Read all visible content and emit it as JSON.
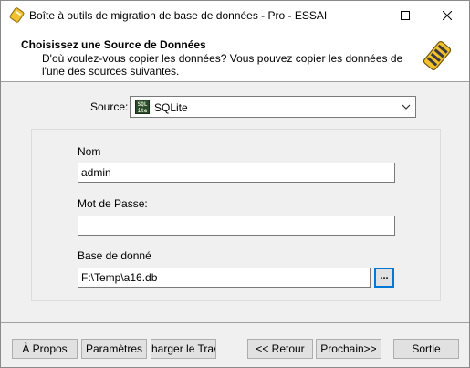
{
  "window": {
    "title": "Boîte à outils de migration de base de données - Pro - ESSAI"
  },
  "header": {
    "title": "Choisissez une Source de Données",
    "description": "D'où voulez-vous copier les données? Vous pouvez copier les données de l'une des sources suivantes."
  },
  "source": {
    "label": "Source:",
    "selected": "SQLite",
    "icon_text_top": "SQL",
    "icon_text_bottom": "ite"
  },
  "form": {
    "name_label": "Nom",
    "name_value": "admin",
    "password_label": "Mot de Passe:",
    "password_value": "",
    "database_label": "Base de donné",
    "database_value": "F:\\Temp\\a16.db",
    "browse_label": "..."
  },
  "buttons": {
    "about": "À Propos",
    "settings": "Paramètres",
    "load_job": "harger le Trava",
    "back": "<< Retour",
    "next": "Prochain>>",
    "exit": "Sortie"
  },
  "colors": {
    "accent": "#0078d7",
    "window_bg": "#f0f0f0",
    "header_bg": "#ffffff"
  }
}
